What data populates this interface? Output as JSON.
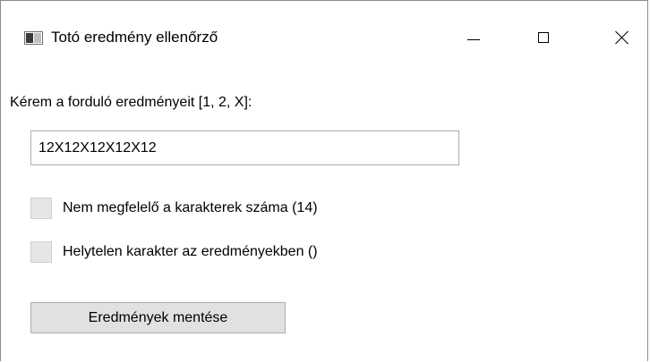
{
  "window": {
    "title": "Totó eredmény ellenőrző",
    "app_icon": "window-app-icon",
    "controls": {
      "minimize_icon": "minimize-icon",
      "maximize_icon": "maximize-icon",
      "close_icon": "close-icon"
    }
  },
  "form": {
    "prompt_label": "Kérem a forduló eredményeit [1, 2, X]:",
    "results_input_value": "12X12X12X12X12",
    "checks": [
      {
        "label": "Nem megfelelő a karakterek száma (14)",
        "checked": false
      },
      {
        "label": "Helytelen karakter az eredményekben ()",
        "checked": false
      }
    ],
    "save_button_label": "Eredmények mentése"
  },
  "colors": {
    "background": "#ffffff",
    "button_face": "#e1e1e1",
    "border": "#adadad",
    "checkbox_fill": "#e6e6e6"
  }
}
